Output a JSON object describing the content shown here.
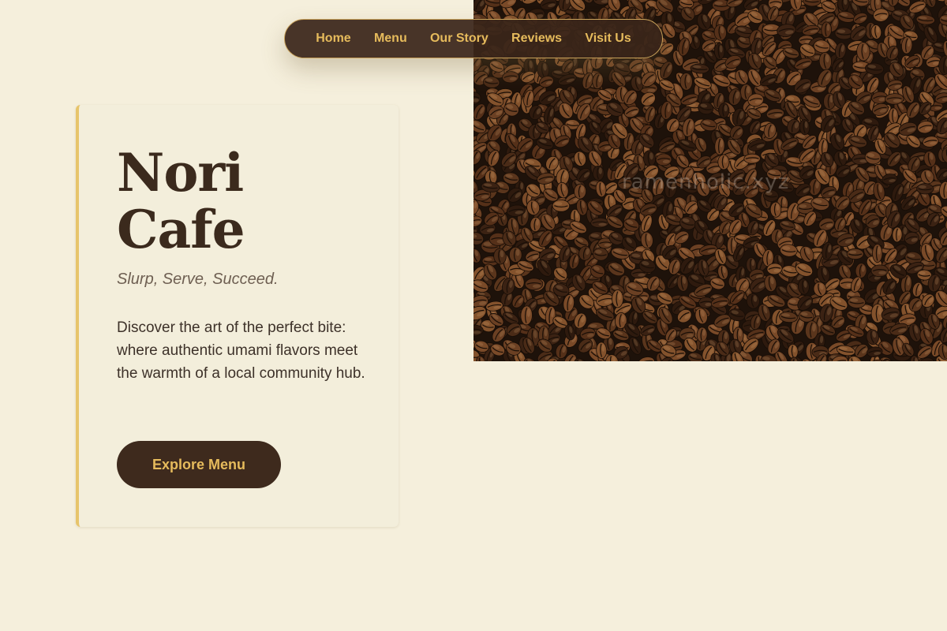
{
  "nav": {
    "items": [
      {
        "label": "Home"
      },
      {
        "label": "Menu"
      },
      {
        "label": "Our Story"
      },
      {
        "label": "Reviews"
      },
      {
        "label": "Visit Us"
      }
    ]
  },
  "hero": {
    "title_line1": "Nori",
    "title_line2": "Cafe",
    "tagline": "Slurp, Serve, Succeed.",
    "description": "Discover the art of the perfect bite: where authentic umami flavors meet the warmth of a local community hub.",
    "cta_label": "Explore Menu"
  },
  "image": {
    "subject": "coffee beans",
    "watermark": "ramenholic.xyz"
  },
  "colors": {
    "background": "#f5efdc",
    "dark_brown": "#3e2a1d",
    "gold_accent": "#e6bb5c",
    "card_border": "#e7c46a"
  }
}
